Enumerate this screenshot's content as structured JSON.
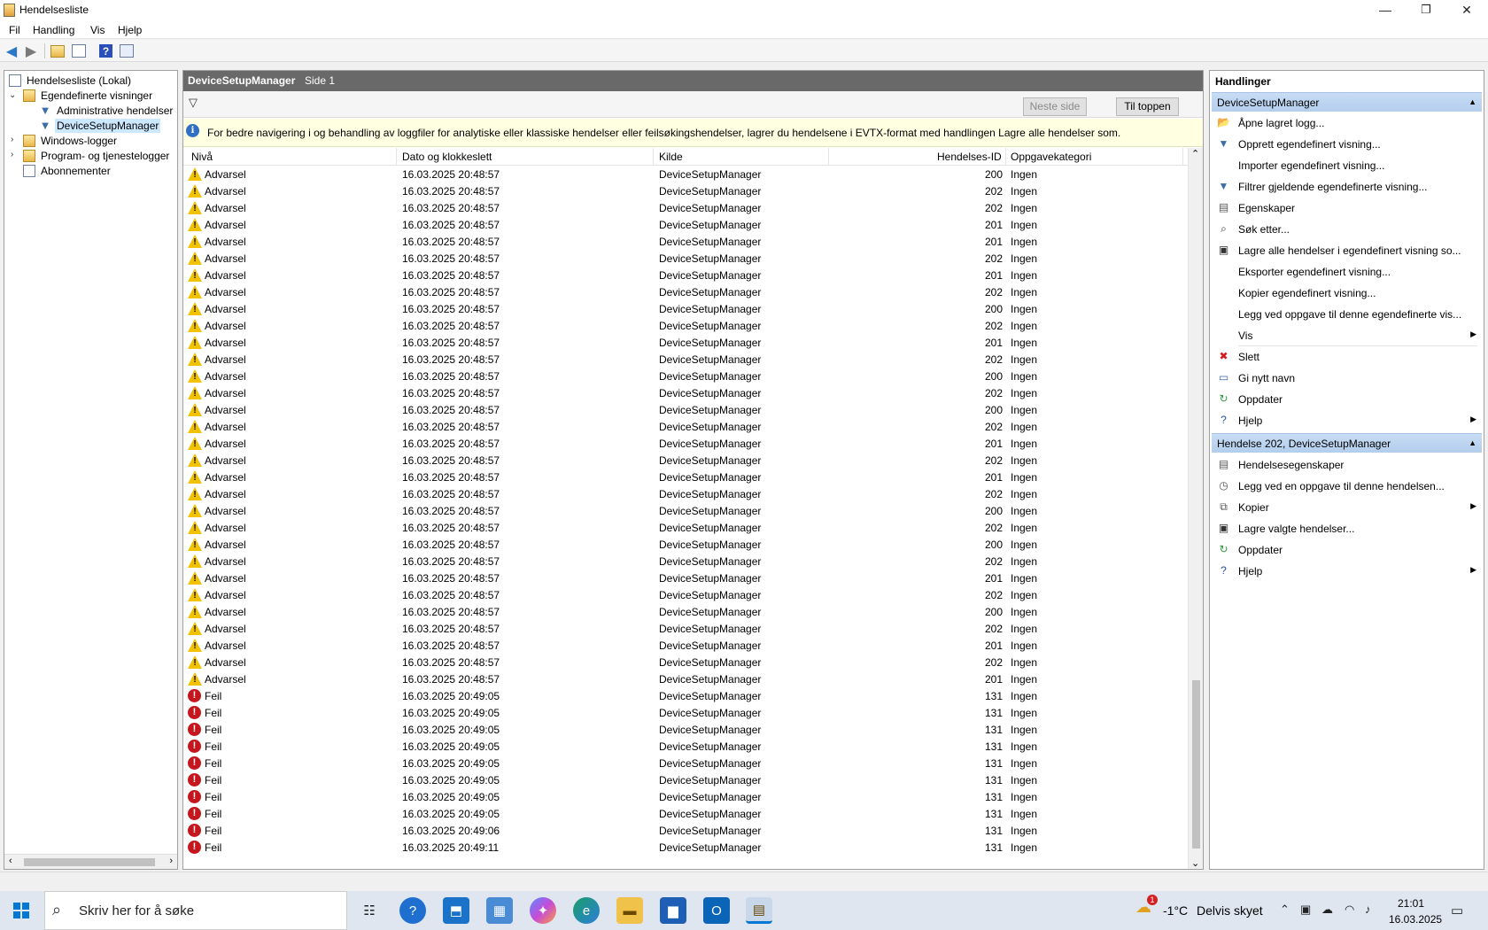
{
  "window": {
    "title": "Hendelsesliste",
    "minimize": "—",
    "restore": "❐",
    "close": "✕"
  },
  "menu": [
    "Fil",
    "Handling",
    "Vis",
    "Hjelp"
  ],
  "tree": {
    "root": "Hendelsesliste (Lokal)",
    "custom_views": "Egendefinerte visninger",
    "admin_events": "Administrative hendelser",
    "dsm": "DeviceSetupManager",
    "windows_logs": "Windows-logger",
    "app_logs": "Program- og tjenestelogger",
    "subscriptions": "Abonnementer"
  },
  "center": {
    "title": "DeviceSetupManager",
    "page": "Side 1",
    "next_page": "Neste side",
    "to_top": "Til toppen",
    "info": "For bedre navigering i og behandling av loggfiler for analytiske eller klassiske hendelser eller feilsøkingshendelser, lagrer du hendelsene i EVTX-format med handlingen Lagre alle hendelser som.",
    "columns": {
      "level": "Nivå",
      "datetime": "Dato og klokkeslett",
      "source": "Kilde",
      "event_id": "Hendelses-ID",
      "task": "Oppgavekategori"
    }
  },
  "events": [
    {
      "level": "Advarsel",
      "type": "warning",
      "datetime": "16.03.2025 20:48:57",
      "source": "DeviceSetupManager",
      "id": "200",
      "task": "Ingen"
    },
    {
      "level": "Advarsel",
      "type": "warning",
      "datetime": "16.03.2025 20:48:57",
      "source": "DeviceSetupManager",
      "id": "202",
      "task": "Ingen"
    },
    {
      "level": "Advarsel",
      "type": "warning",
      "datetime": "16.03.2025 20:48:57",
      "source": "DeviceSetupManager",
      "id": "202",
      "task": "Ingen"
    },
    {
      "level": "Advarsel",
      "type": "warning",
      "datetime": "16.03.2025 20:48:57",
      "source": "DeviceSetupManager",
      "id": "201",
      "task": "Ingen"
    },
    {
      "level": "Advarsel",
      "type": "warning",
      "datetime": "16.03.2025 20:48:57",
      "source": "DeviceSetupManager",
      "id": "201",
      "task": "Ingen"
    },
    {
      "level": "Advarsel",
      "type": "warning",
      "datetime": "16.03.2025 20:48:57",
      "source": "DeviceSetupManager",
      "id": "202",
      "task": "Ingen"
    },
    {
      "level": "Advarsel",
      "type": "warning",
      "datetime": "16.03.2025 20:48:57",
      "source": "DeviceSetupManager",
      "id": "201",
      "task": "Ingen"
    },
    {
      "level": "Advarsel",
      "type": "warning",
      "datetime": "16.03.2025 20:48:57",
      "source": "DeviceSetupManager",
      "id": "202",
      "task": "Ingen"
    },
    {
      "level": "Advarsel",
      "type": "warning",
      "datetime": "16.03.2025 20:48:57",
      "source": "DeviceSetupManager",
      "id": "200",
      "task": "Ingen"
    },
    {
      "level": "Advarsel",
      "type": "warning",
      "datetime": "16.03.2025 20:48:57",
      "source": "DeviceSetupManager",
      "id": "202",
      "task": "Ingen"
    },
    {
      "level": "Advarsel",
      "type": "warning",
      "datetime": "16.03.2025 20:48:57",
      "source": "DeviceSetupManager",
      "id": "201",
      "task": "Ingen"
    },
    {
      "level": "Advarsel",
      "type": "warning",
      "datetime": "16.03.2025 20:48:57",
      "source": "DeviceSetupManager",
      "id": "202",
      "task": "Ingen"
    },
    {
      "level": "Advarsel",
      "type": "warning",
      "datetime": "16.03.2025 20:48:57",
      "source": "DeviceSetupManager",
      "id": "200",
      "task": "Ingen"
    },
    {
      "level": "Advarsel",
      "type": "warning",
      "datetime": "16.03.2025 20:48:57",
      "source": "DeviceSetupManager",
      "id": "202",
      "task": "Ingen"
    },
    {
      "level": "Advarsel",
      "type": "warning",
      "datetime": "16.03.2025 20:48:57",
      "source": "DeviceSetupManager",
      "id": "200",
      "task": "Ingen"
    },
    {
      "level": "Advarsel",
      "type": "warning",
      "datetime": "16.03.2025 20:48:57",
      "source": "DeviceSetupManager",
      "id": "202",
      "task": "Ingen"
    },
    {
      "level": "Advarsel",
      "type": "warning",
      "datetime": "16.03.2025 20:48:57",
      "source": "DeviceSetupManager",
      "id": "201",
      "task": "Ingen"
    },
    {
      "level": "Advarsel",
      "type": "warning",
      "datetime": "16.03.2025 20:48:57",
      "source": "DeviceSetupManager",
      "id": "202",
      "task": "Ingen"
    },
    {
      "level": "Advarsel",
      "type": "warning",
      "datetime": "16.03.2025 20:48:57",
      "source": "DeviceSetupManager",
      "id": "201",
      "task": "Ingen"
    },
    {
      "level": "Advarsel",
      "type": "warning",
      "datetime": "16.03.2025 20:48:57",
      "source": "DeviceSetupManager",
      "id": "202",
      "task": "Ingen"
    },
    {
      "level": "Advarsel",
      "type": "warning",
      "datetime": "16.03.2025 20:48:57",
      "source": "DeviceSetupManager",
      "id": "200",
      "task": "Ingen"
    },
    {
      "level": "Advarsel",
      "type": "warning",
      "datetime": "16.03.2025 20:48:57",
      "source": "DeviceSetupManager",
      "id": "202",
      "task": "Ingen"
    },
    {
      "level": "Advarsel",
      "type": "warning",
      "datetime": "16.03.2025 20:48:57",
      "source": "DeviceSetupManager",
      "id": "200",
      "task": "Ingen"
    },
    {
      "level": "Advarsel",
      "type": "warning",
      "datetime": "16.03.2025 20:48:57",
      "source": "DeviceSetupManager",
      "id": "202",
      "task": "Ingen"
    },
    {
      "level": "Advarsel",
      "type": "warning",
      "datetime": "16.03.2025 20:48:57",
      "source": "DeviceSetupManager",
      "id": "201",
      "task": "Ingen"
    },
    {
      "level": "Advarsel",
      "type": "warning",
      "datetime": "16.03.2025 20:48:57",
      "source": "DeviceSetupManager",
      "id": "202",
      "task": "Ingen"
    },
    {
      "level": "Advarsel",
      "type": "warning",
      "datetime": "16.03.2025 20:48:57",
      "source": "DeviceSetupManager",
      "id": "200",
      "task": "Ingen"
    },
    {
      "level": "Advarsel",
      "type": "warning",
      "datetime": "16.03.2025 20:48:57",
      "source": "DeviceSetupManager",
      "id": "202",
      "task": "Ingen"
    },
    {
      "level": "Advarsel",
      "type": "warning",
      "datetime": "16.03.2025 20:48:57",
      "source": "DeviceSetupManager",
      "id": "201",
      "task": "Ingen"
    },
    {
      "level": "Advarsel",
      "type": "warning",
      "datetime": "16.03.2025 20:48:57",
      "source": "DeviceSetupManager",
      "id": "202",
      "task": "Ingen"
    },
    {
      "level": "Advarsel",
      "type": "warning",
      "datetime": "16.03.2025 20:48:57",
      "source": "DeviceSetupManager",
      "id": "201",
      "task": "Ingen"
    },
    {
      "level": "Feil",
      "type": "error",
      "datetime": "16.03.2025 20:49:05",
      "source": "DeviceSetupManager",
      "id": "131",
      "task": "Ingen"
    },
    {
      "level": "Feil",
      "type": "error",
      "datetime": "16.03.2025 20:49:05",
      "source": "DeviceSetupManager",
      "id": "131",
      "task": "Ingen"
    },
    {
      "level": "Feil",
      "type": "error",
      "datetime": "16.03.2025 20:49:05",
      "source": "DeviceSetupManager",
      "id": "131",
      "task": "Ingen"
    },
    {
      "level": "Feil",
      "type": "error",
      "datetime": "16.03.2025 20:49:05",
      "source": "DeviceSetupManager",
      "id": "131",
      "task": "Ingen"
    },
    {
      "level": "Feil",
      "type": "error",
      "datetime": "16.03.2025 20:49:05",
      "source": "DeviceSetupManager",
      "id": "131",
      "task": "Ingen"
    },
    {
      "level": "Feil",
      "type": "error",
      "datetime": "16.03.2025 20:49:05",
      "source": "DeviceSetupManager",
      "id": "131",
      "task": "Ingen"
    },
    {
      "level": "Feil",
      "type": "error",
      "datetime": "16.03.2025 20:49:05",
      "source": "DeviceSetupManager",
      "id": "131",
      "task": "Ingen"
    },
    {
      "level": "Feil",
      "type": "error",
      "datetime": "16.03.2025 20:49:05",
      "source": "DeviceSetupManager",
      "id": "131",
      "task": "Ingen"
    },
    {
      "level": "Feil",
      "type": "error",
      "datetime": "16.03.2025 20:49:06",
      "source": "DeviceSetupManager",
      "id": "131",
      "task": "Ingen"
    },
    {
      "level": "Feil",
      "type": "error",
      "datetime": "16.03.2025 20:49:11",
      "source": "DeviceSetupManager",
      "id": "131",
      "task": "Ingen"
    }
  ],
  "actions": {
    "title": "Handlinger",
    "section1": "DeviceSetupManager",
    "items1": [
      {
        "label": "Åpne lagret logg...",
        "icon": "open-folder-icon",
        "glyph": "📂",
        "color": "#d9a520",
        "submenu": false
      },
      {
        "label": "Opprett egendefinert visning...",
        "icon": "create-view-icon",
        "glyph": "▼",
        "color": "#3d6da8",
        "submenu": false
      },
      {
        "label": "Importer egendefinert visning...",
        "icon": "",
        "glyph": "",
        "color": "",
        "submenu": false
      },
      {
        "label": "Filtrer gjeldende egendefinerte visning...",
        "icon": "filter-icon",
        "glyph": "▼",
        "color": "#3d6da8",
        "submenu": false
      },
      {
        "label": "Egenskaper",
        "icon": "properties-icon",
        "glyph": "▤",
        "color": "#555555",
        "submenu": false
      },
      {
        "label": "Søk etter...",
        "icon": "binoculars-icon",
        "glyph": "⌕",
        "color": "#333333",
        "submenu": false
      },
      {
        "label": "Lagre alle hendelser i egendefinert visning so...",
        "icon": "save-icon",
        "glyph": "▣",
        "color": "#333333",
        "submenu": false
      },
      {
        "label": "Eksporter egendefinert visning...",
        "icon": "",
        "glyph": "",
        "color": "",
        "submenu": false
      },
      {
        "label": "Kopier egendefinert visning...",
        "icon": "",
        "glyph": "",
        "color": "",
        "submenu": false
      },
      {
        "label": "Legg ved oppgave til denne egendefinerte vis...",
        "icon": "",
        "glyph": "",
        "color": "",
        "submenu": false
      },
      {
        "label": "Vis",
        "icon": "",
        "glyph": "",
        "color": "",
        "submenu": true
      },
      {
        "label": "Slett",
        "icon": "delete-icon",
        "glyph": "✖",
        "color": "#d41a1a",
        "submenu": false
      },
      {
        "label": "Gi nytt navn",
        "icon": "rename-icon",
        "glyph": "▭",
        "color": "#3d6da8",
        "submenu": false
      },
      {
        "label": "Oppdater",
        "icon": "refresh-icon",
        "glyph": "↻",
        "color": "#2e9a3e",
        "submenu": false
      },
      {
        "label": "Hjelp",
        "icon": "help-icon",
        "glyph": "?",
        "color": "#2a4fb8",
        "submenu": true
      }
    ],
    "section2": "Hendelse 202, DeviceSetupManager",
    "items2": [
      {
        "label": "Hendelsesegenskaper",
        "icon": "event-properties-icon",
        "glyph": "▤",
        "color": "#555555",
        "submenu": false
      },
      {
        "label": "Legg ved en oppgave til denne hendelsen...",
        "icon": "attach-task-icon",
        "glyph": "◷",
        "color": "#555555",
        "submenu": false
      },
      {
        "label": "Kopier",
        "icon": "copy-icon",
        "glyph": "⧉",
        "color": "#555555",
        "submenu": true
      },
      {
        "label": "Lagre valgte hendelser...",
        "icon": "save-icon",
        "glyph": "▣",
        "color": "#333333",
        "submenu": false
      },
      {
        "label": "Oppdater",
        "icon": "refresh-icon",
        "glyph": "↻",
        "color": "#2e9a3e",
        "submenu": false
      },
      {
        "label": "Hjelp",
        "icon": "help-icon",
        "glyph": "?",
        "color": "#2a4fb8",
        "submenu": true
      }
    ]
  },
  "taskbar": {
    "search_placeholder": "Skriv her for å søke",
    "temperature": "-1°C",
    "weather": "Delvis skyet",
    "time": "21:01",
    "date": "16.03.2025",
    "weather_badge": "1"
  },
  "colors": {
    "header_dark": "#696969",
    "info_bg": "#ffffe1",
    "section_blue": "#b3cdec",
    "warning": "#f2c200",
    "error": "#c4161c"
  }
}
